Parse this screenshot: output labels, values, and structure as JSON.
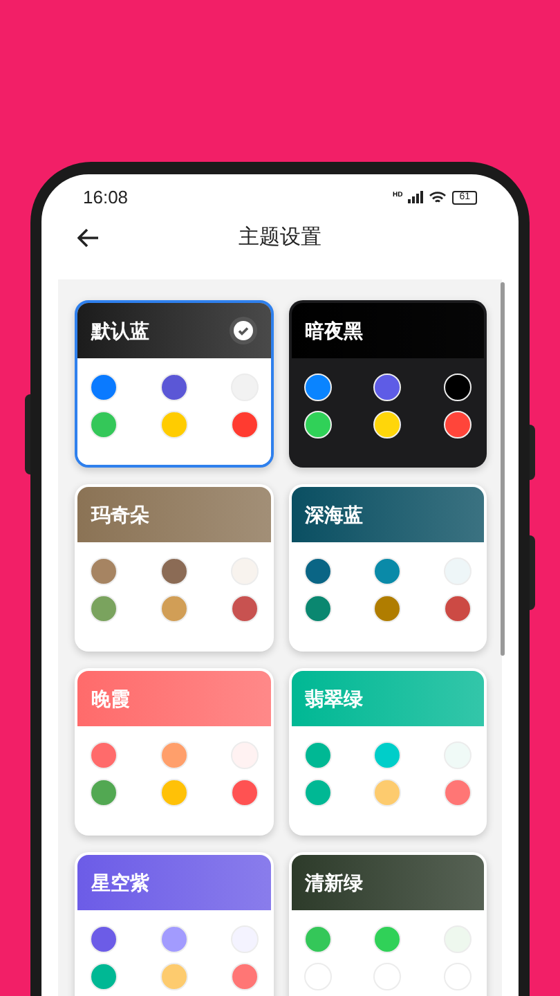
{
  "status_bar": {
    "time": "16:08",
    "network": "HD",
    "battery": "61"
  },
  "header": {
    "title": "主题设置"
  },
  "themes": [
    {
      "name": "默认蓝",
      "selected": true,
      "dark": false,
      "color": "#1c1c1c",
      "dots": [
        {
          "color": "#0a7aff"
        },
        {
          "color": "#5b57d6"
        },
        {
          "color": "#f2f2f2"
        },
        {
          "color": "#34c759"
        },
        {
          "color": "#ffcc00"
        },
        {
          "color": "#ff3b30"
        }
      ]
    },
    {
      "name": "暗夜黑",
      "selected": false,
      "dark": true,
      "color": "#000000",
      "dots": [
        {
          "color": "#0a84ff"
        },
        {
          "color": "#5e5ce6"
        },
        {
          "color": "#000000"
        },
        {
          "color": "#30d158"
        },
        {
          "color": "#ffd60a"
        },
        {
          "color": "#ff453a"
        }
      ]
    },
    {
      "name": "玛奇朵",
      "selected": false,
      "dark": false,
      "color": "#8b7355",
      "dots": [
        {
          "color": "#a68462"
        },
        {
          "color": "#8b6b55"
        },
        {
          "color": "#f8f3ee"
        },
        {
          "color": "#7aa35e"
        },
        {
          "color": "#d19e56"
        },
        {
          "color": "#c85250"
        }
      ]
    },
    {
      "name": "深海蓝",
      "selected": false,
      "dark": false,
      "color": "#0a4f62",
      "dots": [
        {
          "color": "#0a6585"
        },
        {
          "color": "#0a8aa8"
        },
        {
          "color": "#eef6f8"
        },
        {
          "color": "#0a8770"
        },
        {
          "color": "#b07d00"
        },
        {
          "color": "#cc4a44"
        }
      ]
    },
    {
      "name": "晚霞",
      "selected": false,
      "dark": false,
      "color": "#ff6b6b",
      "dots": [
        {
          "color": "#ff6b6b"
        },
        {
          "color": "#ff9f6b"
        },
        {
          "color": "#fff2f2"
        },
        {
          "color": "#52a852"
        },
        {
          "color": "#ffc107"
        },
        {
          "color": "#ff5252"
        }
      ]
    },
    {
      "name": "翡翠绿",
      "selected": false,
      "dark": false,
      "color": "#00b894",
      "dots": [
        {
          "color": "#00b894"
        },
        {
          "color": "#00cec9"
        },
        {
          "color": "#f0faf7"
        },
        {
          "color": "#00b894"
        },
        {
          "color": "#fdcb6e"
        },
        {
          "color": "#ff7675"
        }
      ]
    },
    {
      "name": "星空紫",
      "selected": false,
      "dark": false,
      "color": "#6c5ce7",
      "dots": [
        {
          "color": "#6c5ce7"
        },
        {
          "color": "#a29bfe"
        },
        {
          "color": "#f4f3ff"
        },
        {
          "color": "#00b894"
        },
        {
          "color": "#fdcb6e"
        },
        {
          "color": "#ff7675"
        }
      ]
    },
    {
      "name": "清新绿",
      "selected": false,
      "dark": false,
      "color": "#2d3b2a",
      "dots": [
        {
          "color": "#34c759"
        },
        {
          "color": "#30d158"
        },
        {
          "color": "#eef8ee"
        },
        {
          "color": "#ffffff"
        },
        {
          "color": "#ffffff"
        },
        {
          "color": "#ffffff"
        }
      ]
    }
  ]
}
